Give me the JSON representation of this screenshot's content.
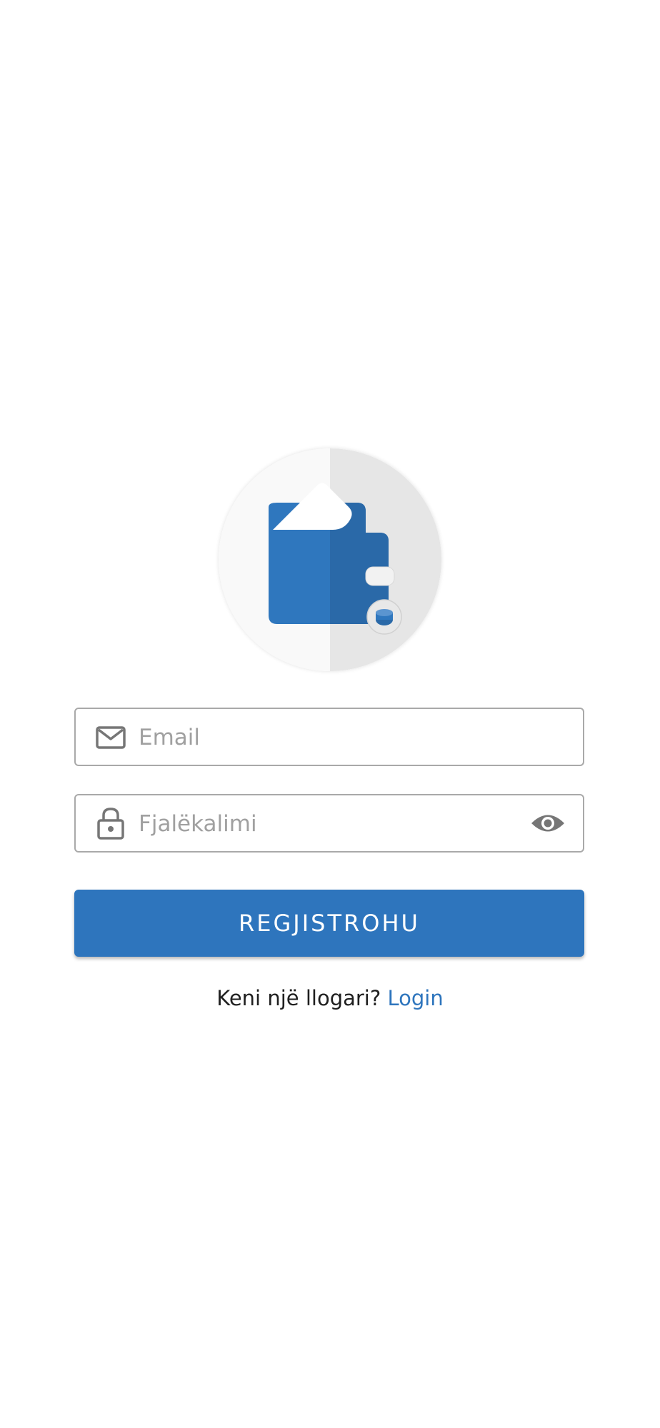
{
  "logo": {
    "icon": "wallet-icon",
    "colors": {
      "wallet": "#2f77be",
      "wallet_shadow": "#2a69a8",
      "circle_left": "#f9f9f9",
      "circle_right": "#e6e6e6"
    }
  },
  "form": {
    "email": {
      "icon": "mail-icon",
      "placeholder": "Email",
      "value": ""
    },
    "password": {
      "icon": "lock-icon",
      "placeholder": "Fjalëkalimi",
      "value": "",
      "toggle_icon": "eye-icon"
    },
    "submit_label": "REGJISTROHU"
  },
  "footer": {
    "prompt": "Keni një llogari?",
    "link_label": "Login"
  },
  "colors": {
    "accent": "#2e75bd",
    "field_border": "#a9a9a9",
    "icon_gray": "#767676",
    "placeholder": "#a0a0a0"
  }
}
